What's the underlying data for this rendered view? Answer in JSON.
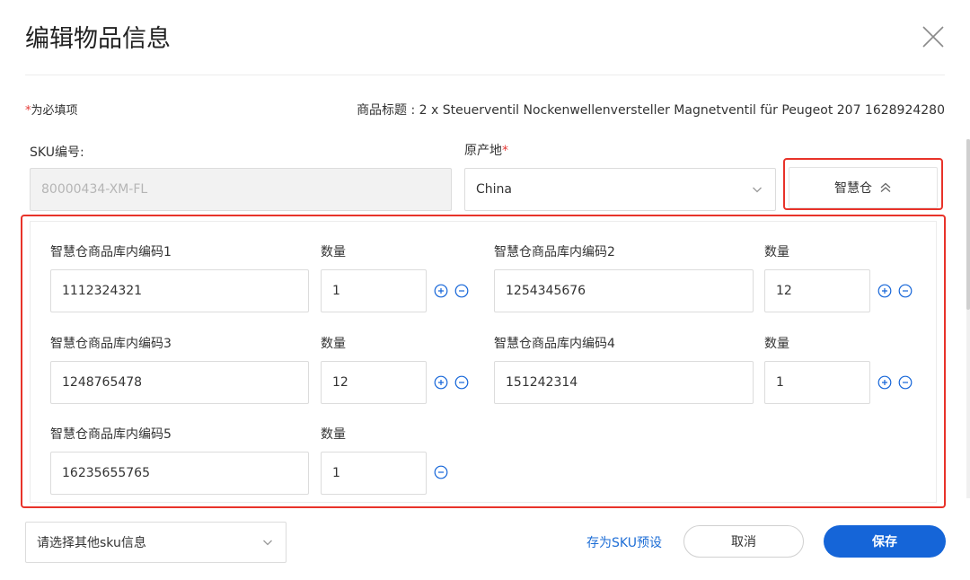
{
  "dialog": {
    "title": "编辑物品信息",
    "required_star": "*",
    "required_note": "为必填项",
    "goods_title": "商品标题 : 2 x Steuerventil Nockenwellenversteller Magnetventil für Peugeot 207 1628924280"
  },
  "form": {
    "sku_label": "SKU编号:",
    "sku_value": "80000434-XM-FL",
    "origin_label": "原产地",
    "origin_star": "*",
    "origin_value": "China",
    "toggle_label": "智慧仓"
  },
  "warehouse": {
    "qty_label": "数量",
    "rows": [
      {
        "code_label": "智慧仓商品库内编码1",
        "code": "1112324321",
        "qty": "1"
      },
      {
        "code_label": "智慧仓商品库内编码2",
        "code": "1254345676",
        "qty": "12"
      },
      {
        "code_label": "智慧仓商品库内编码3",
        "code": "1248765478",
        "qty": "12"
      },
      {
        "code_label": "智慧仓商品库内编码4",
        "code": "151242314",
        "qty": "1"
      },
      {
        "code_label": "智慧仓商品库内编码5",
        "code": "16235655765",
        "qty": "1"
      }
    ]
  },
  "footer": {
    "other_sku_placeholder": "请选择其他sku信息",
    "save_preset": "存为SKU预设",
    "cancel": "取消",
    "save": "保存"
  },
  "colors": {
    "accent": "#1565d8",
    "highlight_border": "#e8332a",
    "required": "#e53935"
  },
  "icons": [
    "close-icon",
    "chevron-down-icon",
    "double-chevron-up-icon",
    "plus-circle-icon",
    "minus-circle-icon"
  ]
}
